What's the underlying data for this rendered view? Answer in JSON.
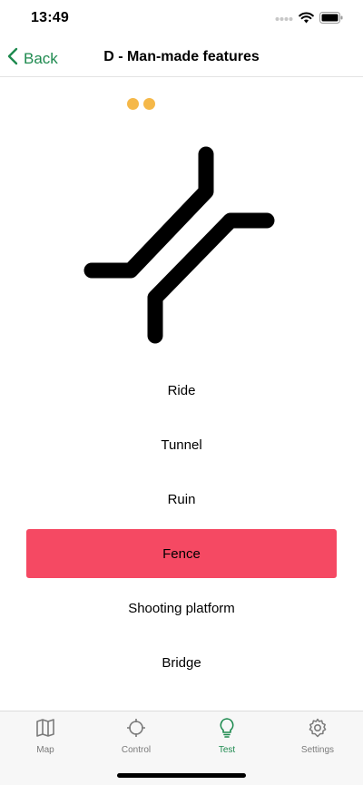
{
  "status_bar": {
    "time": "13:49"
  },
  "nav": {
    "back_label": "Back",
    "title": "D - Man-made features"
  },
  "progress": {
    "answered": 2,
    "color": "#f5b849"
  },
  "question": {
    "symbol": "bridge-map-symbol"
  },
  "options": [
    {
      "label": "Ride",
      "selected": false
    },
    {
      "label": "Tunnel",
      "selected": false
    },
    {
      "label": "Ruin",
      "selected": false
    },
    {
      "label": "Fence",
      "selected": true
    },
    {
      "label": "Shooting platform",
      "selected": false
    },
    {
      "label": "Bridge",
      "selected": false
    }
  ],
  "tabs": [
    {
      "label": "Map",
      "icon": "map-icon",
      "active": false
    },
    {
      "label": "Control",
      "icon": "crosshair-icon",
      "active": false
    },
    {
      "label": "Test",
      "icon": "lightbulb-icon",
      "active": true
    },
    {
      "label": "Settings",
      "icon": "gear-icon",
      "active": false
    }
  ],
  "colors": {
    "accent": "#1e8a4f",
    "selected": "#f54963",
    "progress": "#f5b849"
  }
}
